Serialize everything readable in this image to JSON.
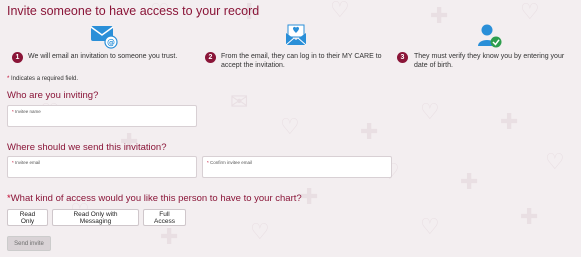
{
  "page": {
    "title": "Invite someone to have access to your record"
  },
  "steps": [
    {
      "number": "1",
      "icon": "email-at-icon",
      "text": "We will email an invitation to someone you trust."
    },
    {
      "number": "2",
      "icon": "open-envelope-heart-icon",
      "text": "From the email, they can log in to their MY CARE to accept the invitation."
    },
    {
      "number": "3",
      "icon": "verified-person-icon",
      "text": "They must verify they know you by entering your date of birth."
    }
  ],
  "required_note": {
    "star": "*",
    "text": "Indicates a required field."
  },
  "who": {
    "heading": "Who are you inviting?",
    "invitee_name": {
      "label": "Invitee name",
      "value": ""
    }
  },
  "where": {
    "heading": "Where should we send this invitation?",
    "invitee_email": {
      "label": "Invitee email",
      "value": ""
    },
    "confirm_email": {
      "label": "Confirm invitee email",
      "value": ""
    }
  },
  "access": {
    "heading": "What kind of access would you like this person to have to your chart?",
    "options": [
      "Read Only",
      "Read Only with Messaging",
      "Full Access"
    ]
  },
  "send_button": {
    "label": "Send invite"
  },
  "colors": {
    "brand": "#8a1538",
    "background": "#f3eef0",
    "icon_blue": "#2a8fd8",
    "check_green": "#2e9e4e"
  }
}
